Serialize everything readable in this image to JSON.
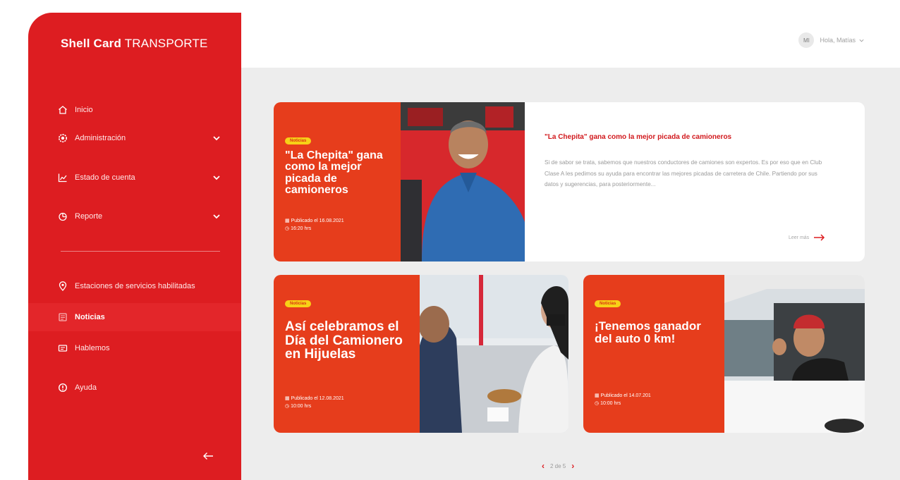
{
  "brand": {
    "bold": "Shell Card",
    "light": "TRANSPORTE"
  },
  "sidebar": {
    "items": [
      {
        "label": "Inicio",
        "icon": "home-icon",
        "has_chevron": false
      },
      {
        "label": "Administración",
        "icon": "gear-icon",
        "has_chevron": true
      },
      {
        "label": "Estado de cuenta",
        "icon": "chart-icon",
        "has_chevron": true
      },
      {
        "label": "Reporte",
        "icon": "pie-icon",
        "has_chevron": true
      }
    ],
    "items2": [
      {
        "label": "Estaciones de servicios habilitadas",
        "icon": "location-pin-icon",
        "active": false
      },
      {
        "label": "Noticias",
        "icon": "news-icon",
        "active": true
      },
      {
        "label": "Hablemos",
        "icon": "chat-icon",
        "active": false
      },
      {
        "label": "Ayuda",
        "icon": "info-icon",
        "active": false
      }
    ],
    "collapse_icon": "arrow-left-icon"
  },
  "header": {
    "avatar_initials": "MI",
    "greeting": "Hola, Matías"
  },
  "featured": {
    "tag": "Noticias",
    "title": "\"La Chepita\" gana como la mejor picada de camioneros",
    "published": "Publicado el 16.08.2021",
    "time": "16:20 hrs",
    "excerpt_title": "\"La Chepita\" gana como la mejor picada de camioneros",
    "excerpt": "Si de sabor se trata, sabemos que nuestros conductores de camiones son expertos. Es por eso que en Club Clase A les pedimos su ayuda para encontrar las mejores picadas de carretera de Chile. Partiendo por sus datos y sugerencias, para posteriormente...",
    "read_more": "Leer más"
  },
  "card2": {
    "tag": "Noticias",
    "title": "Así celebramos el Día del Camionero en Hijuelas",
    "published": "Publicado el 12.08.2021",
    "time": "10:00 hrs"
  },
  "card3": {
    "tag": "Noticias",
    "title": "¡Tenemos ganador del auto 0 km!",
    "published": "Publicado el 14.07.201",
    "time": "10:00 hrs"
  },
  "pager": {
    "label": "2 de 5"
  },
  "colors": {
    "sidebar": "#dd1d21",
    "card_red": "#e63d1c",
    "tag": "#f7d117",
    "background": "#ededed"
  }
}
